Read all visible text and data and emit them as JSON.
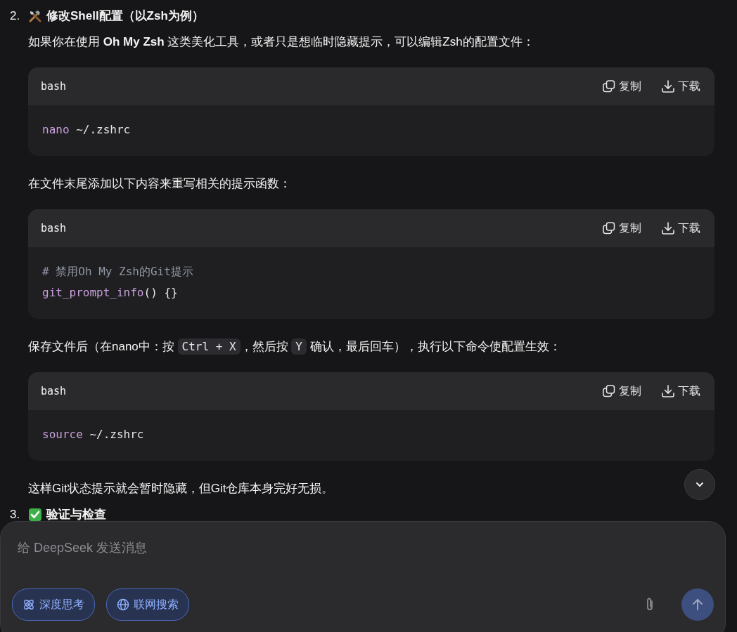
{
  "items": [
    {
      "number": "2.",
      "title": "修改Shell配置（以Zsh为例）",
      "blocks": [
        {
          "kind": "paragraph",
          "segments": [
            {
              "kind": "text",
              "text": "如果你在使用 **Oh My Zsh** 这类美化工具，或者只是想临时隐藏提示，可以编辑Zsh的配置文件："
            }
          ]
        },
        {
          "kind": "code",
          "language": "bash",
          "copy_label": "复制",
          "download_label": "下载",
          "lines": [
            [
              {
                "kind": "keyword",
                "text": "nano"
              },
              {
                "kind": "plain",
                "text": " ~/.zshrc"
              }
            ]
          ]
        },
        {
          "kind": "paragraph",
          "segments": [
            {
              "kind": "text",
              "text": "在文件末尾添加以下内容来重写相关的提示函数："
            }
          ]
        },
        {
          "kind": "code",
          "language": "bash",
          "copy_label": "复制",
          "download_label": "下载",
          "lines": [
            [
              {
                "kind": "comment",
                "text": "# 禁用Oh My Zsh的Git提示"
              }
            ],
            [
              {
                "kind": "keyword",
                "text": "git_prompt_info"
              },
              {
                "kind": "plain",
                "text": "() {}"
              }
            ]
          ]
        },
        {
          "kind": "paragraph",
          "segments": [
            {
              "kind": "text",
              "text": "保存文件后（在nano中：按 "
            },
            {
              "kind": "code",
              "text": "Ctrl + X"
            },
            {
              "kind": "text",
              "text": "，然后按 "
            },
            {
              "kind": "code",
              "text": "Y"
            },
            {
              "kind": "text",
              "text": " 确认，最后回车），执行以下命令使配置生效："
            }
          ]
        },
        {
          "kind": "code",
          "language": "bash",
          "copy_label": "复制",
          "download_label": "下载",
          "lines": [
            [
              {
                "kind": "keyword",
                "text": "source"
              },
              {
                "kind": "plain",
                "text": " ~/.zshrc"
              }
            ]
          ]
        },
        {
          "kind": "paragraph",
          "segments": [
            {
              "kind": "text",
              "text": "这样Git状态提示就会暂时隐藏，但Git仓库本身完好无损。"
            }
          ]
        }
      ]
    },
    {
      "number": "3.",
      "title": "验证与检查"
    }
  ],
  "composer": {
    "placeholder": "给 DeepSeek 发送消息",
    "toggles": [
      {
        "label": "深度思考",
        "selected": true
      },
      {
        "label": "联网搜索",
        "selected": true
      }
    ],
    "send_disabled": true
  }
}
